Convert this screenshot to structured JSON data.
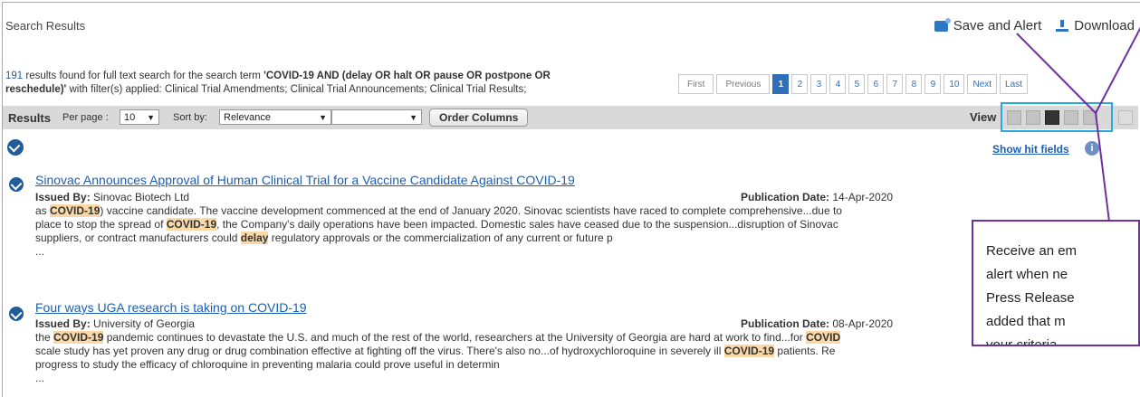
{
  "page": {
    "title": "Search Results"
  },
  "actions": {
    "save_alert": "Save and Alert",
    "download": "Download"
  },
  "summary": {
    "count": "191",
    "line1_rest": " results found for full text search for the search term ",
    "term_line1": "'COVID-19 AND (delay OR halt OR pause OR postpone OR",
    "term_line2": "reschedule)'",
    "line2_rest": " with filter(s) applied:  Clinical Trial Amendments; Clinical Trial Announcements; Clinical Trial Results;"
  },
  "pager": {
    "first": "First",
    "previous": "Previous",
    "pages": [
      "1",
      "2",
      "3",
      "4",
      "5",
      "6",
      "7",
      "8",
      "9",
      "10"
    ],
    "next": "Next",
    "last": "Last",
    "current": "1"
  },
  "toolbar": {
    "results_label": "Results",
    "per_page_label": "Per page :",
    "per_page_value": "10",
    "sort_label": "Sort by:",
    "sort_value": "Relevance",
    "secondary_value": "",
    "order_columns": "Order Columns",
    "view_label": "View"
  },
  "show_hit_fields": "Show hit fields",
  "results": [
    {
      "title": "Sinovac Announces Approval of Human Clinical Trial for a Vaccine Candidate Against COVID-19",
      "issued_label": "Issued By:",
      "issued_by": "Sinovac Biotech Ltd",
      "pub_label": "Publication Date:",
      "pub_date": "14-Apr-2020",
      "snippet_lines": [
        [
          "as ",
          "#COVID-19",
          ") vaccine candidate. The vaccine development commenced at the end of January 2020. Sinovac scientists have raced to complete comprehensive...due to"
        ],
        [
          "place to stop the spread of ",
          "#COVID-19",
          ", the Company's daily operations have been impacted. Domestic sales have ceased due to the suspension...disruption of Sinovac"
        ],
        [
          "suppliers, or contract manufacturers could ",
          "#delay",
          " regulatory approvals or the commercialization of any current or future p"
        ],
        [
          "..."
        ]
      ]
    },
    {
      "title": "Four ways UGA research is taking on COVID-19",
      "issued_label": "Issued By:",
      "issued_by": "University of Georgia",
      "pub_label": "Publication Date:",
      "pub_date": "08-Apr-2020",
      "snippet_lines": [
        [
          "the ",
          "#COVID-19",
          " pandemic continues to devastate the U.S. and much of the rest of the world, researchers at the University of Georgia are hard at work to find...for ",
          "#COVID"
        ],
        [
          "scale study has yet proven any drug or drug combination effective at fighting off the virus. There's also no...of hydroxychloroquine in severely ill ",
          "#COVID-19",
          " patients. Re"
        ],
        [
          "progress to study the efficacy of chloroquine in preventing malaria could prove useful in determin"
        ],
        [
          "..."
        ]
      ]
    }
  ],
  "callout": {
    "lines": [
      "Receive an em",
      "alert when ne",
      "Press Release",
      "added that m",
      "your criteria."
    ]
  },
  "colors": {
    "accent": "#1f5c99",
    "link": "#1a5fb4",
    "callout_border": "#7030a0",
    "view_highlight": "#29a9e1",
    "highlight": "#fbd8a8"
  }
}
